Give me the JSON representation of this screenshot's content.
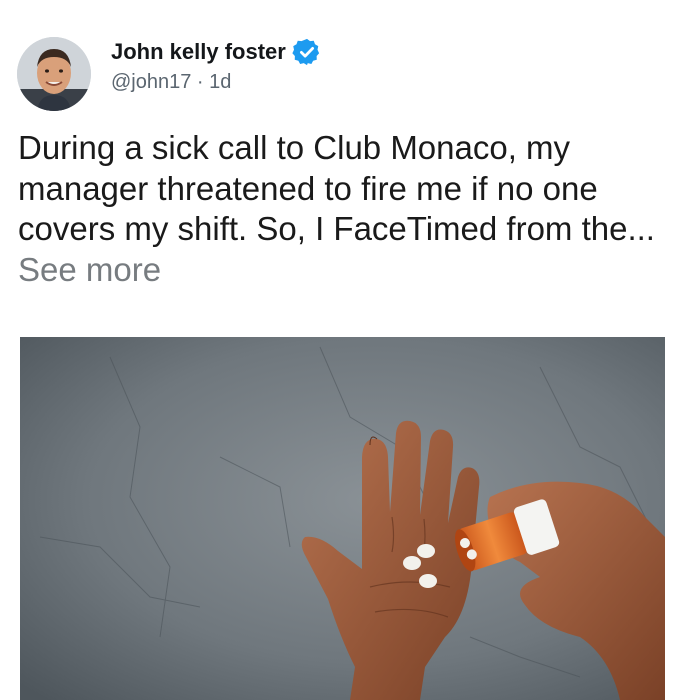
{
  "author": {
    "display_name": "John kelly foster",
    "verified": true,
    "handle": "@john17",
    "separator": " · ",
    "time_ago": "1d"
  },
  "tweet": {
    "text": "During a sick call to Club Monaco, my manager threatened to fire me if no one covers my shift. So, I FaceTimed from the... ",
    "see_more_label": "See more"
  },
  "media": {
    "kind": "photo",
    "subject": "hands-with-pills-and-pill-bottle"
  },
  "colors": {
    "verified_blue": "#1d9bf0",
    "text": "#1a1a1a",
    "muted": "#777c80",
    "pill_bottle": "#e8712a"
  }
}
